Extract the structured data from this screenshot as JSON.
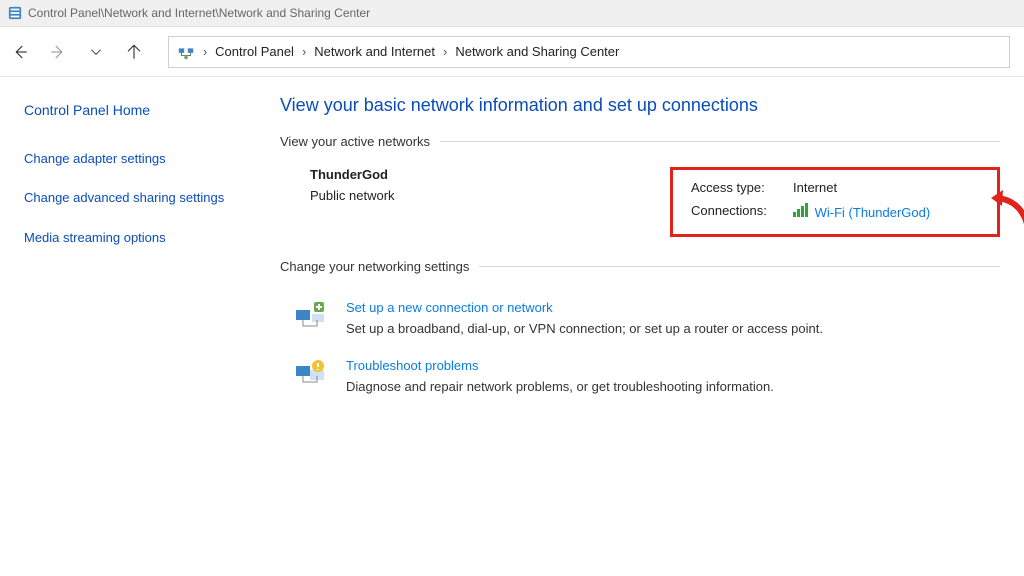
{
  "titlebar": {
    "path": "Control Panel\\Network and Internet\\Network and Sharing Center"
  },
  "breadcrumb": {
    "items": [
      "Control Panel",
      "Network and Internet",
      "Network and Sharing Center"
    ]
  },
  "sidebar": {
    "home": "Control Panel Home",
    "links": [
      "Change adapter settings",
      "Change advanced sharing settings",
      "Media streaming options"
    ]
  },
  "main": {
    "heading": "View your basic network information and set up connections",
    "active_section_label": "View your active networks",
    "network": {
      "name": "ThunderGod",
      "type": "Public network",
      "access_label": "Access type:",
      "access_value": "Internet",
      "conn_label": "Connections:",
      "conn_value": "Wi-Fi (ThunderGod)"
    },
    "change_section_label": "Change your networking settings",
    "tasks": [
      {
        "title": "Set up a new connection or network",
        "desc": "Set up a broadband, dial-up, or VPN connection; or set up a router or access point."
      },
      {
        "title": "Troubleshoot problems",
        "desc": "Diagnose and repair network problems, or get troubleshooting information."
      }
    ]
  },
  "annotation": {
    "highlight_color": "#e0241b"
  }
}
